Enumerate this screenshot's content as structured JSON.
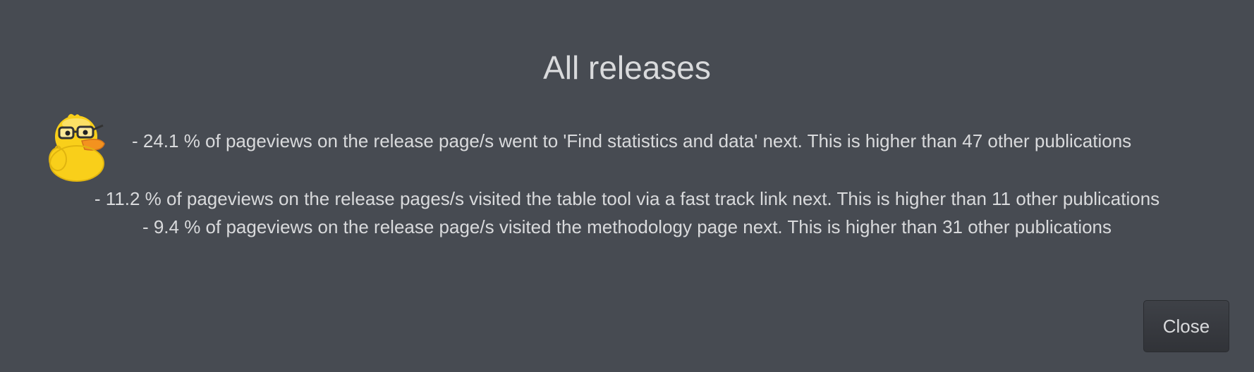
{
  "dialog": {
    "title": "All releases",
    "stats": [
      "- 24.1 % of pageviews on the release page/s went to 'Find statistics and data' next. This is higher than 47 other publications",
      "- 11.2 % of pageviews on the release pages/s visited the table tool via a fast track link next. This is higher than 11 other publications",
      "- 9.4 % of pageviews on the release page/s visited the methodology page next. This is higher than 31 other publications"
    ],
    "mascot_icon": "duck-with-glasses-thinking-icon",
    "close_label": "Close"
  },
  "colors": {
    "background": "#474b52",
    "text": "#d9dadc",
    "button": "#35383d",
    "duck_yellow": "#f9cf1a",
    "duck_beak": "#f3921f"
  }
}
